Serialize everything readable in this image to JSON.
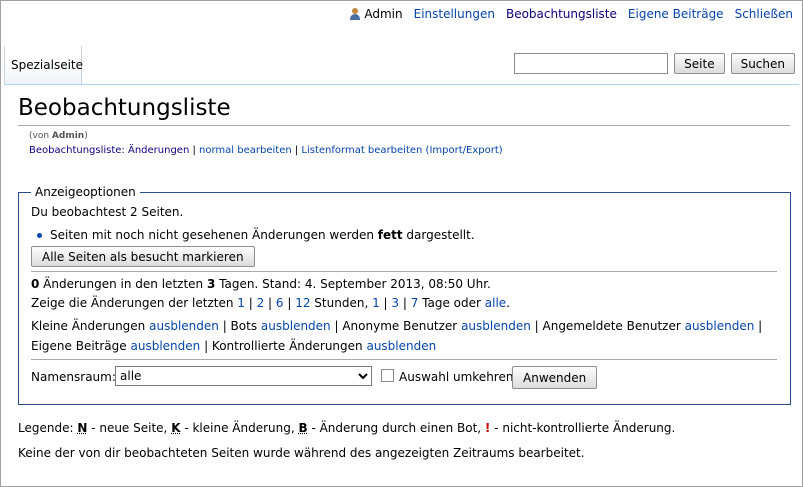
{
  "personal": {
    "user": "Admin",
    "settings": "Einstellungen",
    "watchlist": "Beobachtungsliste",
    "contributions": "Eigene Beiträge",
    "close": "Schließen"
  },
  "tab": {
    "label": "Spezialseite"
  },
  "search": {
    "value": "",
    "go_label": "Seite",
    "search_label": "Suchen"
  },
  "page": {
    "title": "Beobachtungsliste",
    "sub_prefix": "(von ",
    "sub_user": "Admin",
    "sub_suffix": ")",
    "tools": {
      "changes": "Beobachtungsliste: Änderungen",
      "sep1": " | ",
      "edit": "normal bearbeiten",
      "sep2": " | ",
      "raw": "Listenformat bearbeiten (Import/Export)"
    }
  },
  "options": {
    "legend": "Anzeigeoptionen",
    "watching": "Du beobachtest 2 Seiten.",
    "bullet_pre": "Seiten mit noch nicht gesehenen Änderungen werden ",
    "bullet_bold": "fett",
    "bullet_post": " dargestellt.",
    "mark_all": "Alle Seiten als besucht markieren",
    "changes_count": "0",
    "changes_text1": " Änderungen in den letzten ",
    "changes_days": "3",
    "changes_text2": " Tagen. Stand: 4. September 2013, 08:50 Uhr.",
    "show_prefix": "Zeige die Änderungen der letzten ",
    "hours": [
      "1",
      "2",
      "6",
      "12"
    ],
    "hours_suffix": " Stunden, ",
    "days": [
      "1",
      "3",
      "7"
    ],
    "days_suffix": " Tage oder ",
    "all": "alle",
    "period": ".",
    "filters": [
      {
        "label": "Kleine Änderungen ",
        "link": "ausblenden"
      },
      {
        "label": "Bots ",
        "link": "ausblenden"
      },
      {
        "label": "Anonyme Benutzer ",
        "link": "ausblenden"
      },
      {
        "label": "Angemeldete Benutzer ",
        "link": "ausblenden"
      },
      {
        "label": "Eigene Beiträge ",
        "link": "ausblenden"
      },
      {
        "label": "Kontrollierte Änderungen ",
        "link": "ausblenden"
      }
    ],
    "namespace_label": "Namensraum:",
    "namespace_value": "alle",
    "invert_label": "Auswahl umkehren",
    "apply_label": "Anwenden"
  },
  "legend": {
    "prefix": "Legende: ",
    "n": "N",
    "n_text": " - neue Seite, ",
    "k": "K",
    "k_text": " - kleine Änderung, ",
    "b": "B",
    "b_text": " - Änderung durch einen Bot, ",
    "u": "!",
    "u_text": " - nicht-kontrollierte Änderung."
  },
  "empty_message": "Keine der von dir beobachteten Seiten wurde während des angezeigten Zeitraums bearbeitet."
}
